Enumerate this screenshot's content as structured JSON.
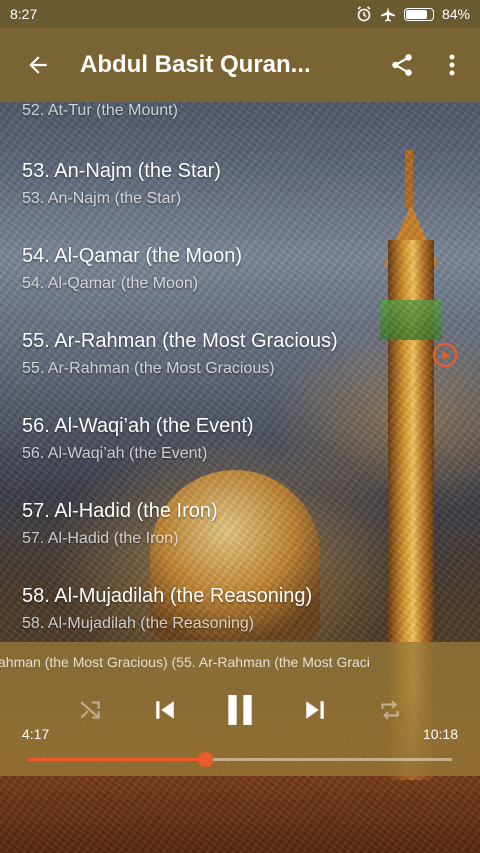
{
  "status_bar": {
    "time": "8:27",
    "battery_percent": "84%",
    "battery_level": 0.84,
    "icons": [
      "alarm-icon",
      "airplane-mode-icon",
      "battery-icon"
    ]
  },
  "app_bar": {
    "title": "Abdul Basit Quran...",
    "back_icon": "arrow-left-icon",
    "share_icon": "share-icon",
    "menu_icon": "more-vert-icon"
  },
  "tracks": [
    {
      "title": "52. At-Tur (the Mount)",
      "subtitle": "52. At-Tur (the Mount)"
    },
    {
      "title": "53. An-Najm (the Star)",
      "subtitle": "53. An-Najm (the Star)"
    },
    {
      "title": "54. Al-Qamar (the Moon)",
      "subtitle": "54. Al-Qamar (the Moon)"
    },
    {
      "title": "55. Ar-Rahman (the Most Gracious)",
      "subtitle": "55. Ar-Rahman (the Most Gracious)",
      "playing": true
    },
    {
      "title": "56. Al-Waqi’ah (the Event)",
      "subtitle": "56. Al-Waqi’ah (the Event)"
    },
    {
      "title": "57. Al-Hadid (the Iron)",
      "subtitle": "57. Al-Hadid (the Iron)"
    },
    {
      "title": "58. Al-Mujadilah (the Reasoning)",
      "subtitle": "58. Al-Mujadilah (the Reasoning)"
    }
  ],
  "player": {
    "now_playing": "ahman (the Most Gracious) (55. Ar-Rahman (the Most Graci",
    "elapsed": "4:17",
    "duration": "10:18",
    "progress": 0.417,
    "controls": [
      "shuffle-icon",
      "skip-previous-icon",
      "pause-icon",
      "skip-next-icon",
      "repeat-icon"
    ]
  },
  "colors": {
    "accent": "#ee5b2a",
    "app_bar": "#7a6433",
    "player_panel": "#967837"
  }
}
